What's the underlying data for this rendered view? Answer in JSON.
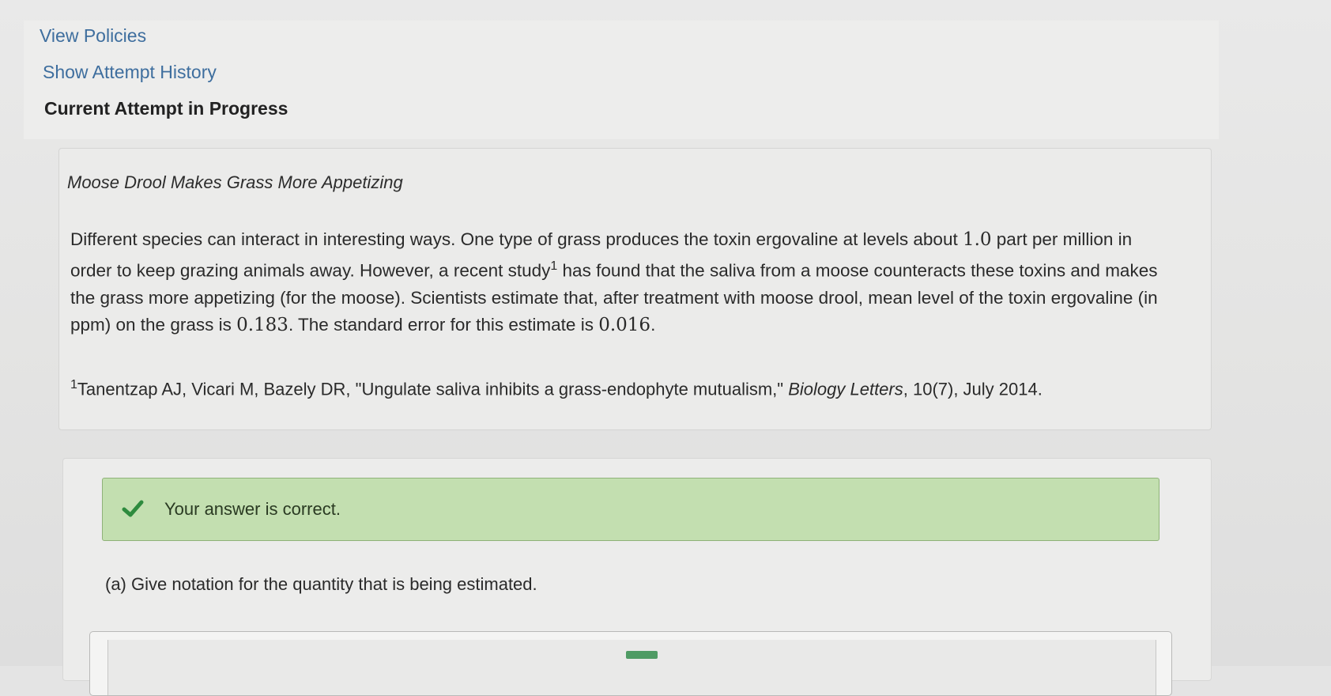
{
  "nav": {
    "view_policies": "View Policies",
    "show_attempt_history": "Show Attempt History",
    "current_attempt": "Current Attempt in Progress"
  },
  "question": {
    "title": "Moose Drool Makes Grass More Appetizing",
    "text_1": "Different species can interact in interesting ways. One type of grass produces the toxin ergovaline at levels about ",
    "value_ppm": "1.0",
    "text_2": " part per million in order to keep grazing animals away. However, a recent study",
    "footnote_marker": "1",
    "text_3": " has found that the saliva from a moose counteracts these toxins and makes the grass more appetizing (for the moose). Scientists estimate that, after treatment with moose drool, mean level of the toxin ergovaline (in ppm) on the grass is ",
    "mean_value": "0.183",
    "text_4": ". The standard error for this estimate is ",
    "se_value": "0.016",
    "text_5": ".",
    "footnote_sup": "1",
    "footnote_authors": "Tanentzap AJ, Vicari M, Bazely DR, \"Ungulate saliva inhibits a grass-endophyte mutualism,\" ",
    "footnote_journal": "Biology Letters",
    "footnote_details": ", 10(7), July 2014."
  },
  "feedback": {
    "message": "Your answer is correct.",
    "icon": "check-icon",
    "color": "#c3dfb0"
  },
  "part_a": {
    "prompt": "(a) Give notation for the quantity that is being estimated."
  },
  "colors": {
    "link": "#3e6e9e",
    "success": "#2e8b3e"
  }
}
